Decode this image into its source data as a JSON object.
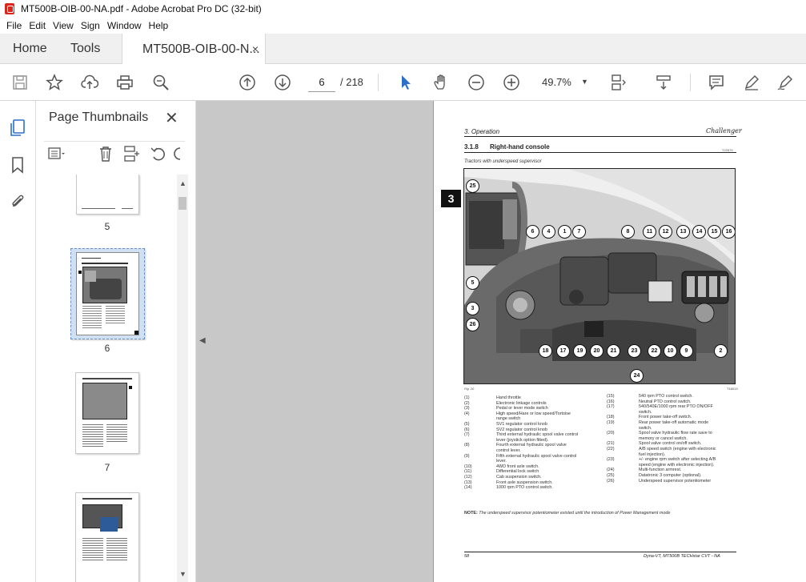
{
  "window": {
    "title": "MT500B-OIB-00-NA.pdf - Adobe Acrobat Pro DC (32-bit)"
  },
  "menu": [
    "File",
    "Edit",
    "View",
    "Sign",
    "Window",
    "Help"
  ],
  "tabs": {
    "home": "Home",
    "tools": "Tools",
    "document": "MT500B-OIB-00-N...",
    "close": "×"
  },
  "toolbar": {
    "page_current": "6",
    "page_total": "/  218",
    "zoom": "49.7%"
  },
  "panel": {
    "title": "Page Thumbnails",
    "close": "✕",
    "thumbnails": [
      {
        "label": "5"
      },
      {
        "label": "6",
        "selected": true
      },
      {
        "label": "7"
      }
    ]
  },
  "page": {
    "section": "3. Operation",
    "logo": "Challenger",
    "heading_num": "3.1.8",
    "heading": "Right-hand console",
    "code": "T22679",
    "subtitle": "Tractors with underspeed supervisor",
    "figure_badge": "3",
    "fig_caption": "Fig. 20",
    "fig_code": "T16013",
    "callouts": [
      "25",
      "6",
      "4",
      "1",
      "7",
      "8",
      "11",
      "12",
      "13",
      "14",
      "15",
      "16",
      "5",
      "3",
      "26",
      "18",
      "17",
      "19",
      "20",
      "21",
      "23",
      "22",
      "10",
      "9",
      "2",
      "24"
    ],
    "legend_left": [
      {
        "n": "(1)",
        "t": "Hand throttle"
      },
      {
        "n": "(2)",
        "t": "Electronic linkage controls"
      },
      {
        "n": "(3)",
        "t": "Pedal or lever mode switch"
      },
      {
        "n": "(4)",
        "t": "High speed/Hare or low speed/Tortoise",
        "t2": "range switch"
      },
      {
        "n": "(5)",
        "t": "SV1 regulator control knob"
      },
      {
        "n": "(6)",
        "t": "SV2 regulator control knob"
      },
      {
        "n": "(7)",
        "t": "Third external hydraulic spool valve control",
        "t2": "lever (joystick option fitted)."
      },
      {
        "n": "(8)",
        "t": "Fourth external hydraulic spool valve",
        "t2": "control lever."
      },
      {
        "n": "(9)",
        "t": "Fifth external hydraulic spool valve control",
        "t2": "lever."
      },
      {
        "n": "(10)",
        "t": "4WD front axle switch."
      },
      {
        "n": "(11)",
        "t": "Differential lock switch"
      },
      {
        "n": "(12)",
        "t": "Cab suspension switch."
      },
      {
        "n": "(13)",
        "t": "Front axle suspension switch."
      },
      {
        "n": "(14)",
        "t": "1000 rpm PTO control switch."
      }
    ],
    "legend_right": [
      {
        "n": "(15)",
        "t": "540 rpm PTO control switch."
      },
      {
        "n": "(16)",
        "t": "Neutral PTO control switch."
      },
      {
        "n": "(17)",
        "t": "540/540E/1000 rpm rear PTO ON/OFF",
        "t2": "switch."
      },
      {
        "n": "(18)",
        "t": "Front power take-off switch."
      },
      {
        "n": "(19)",
        "t": "Rear power take-off automatic mode",
        "t2": "switch."
      },
      {
        "n": "(20)",
        "t": "Spool valve hydraulic flow rate save to",
        "t2": "memory or cancel switch."
      },
      {
        "n": "(21)",
        "t": "Spool valve control on/off switch."
      },
      {
        "n": "(22)",
        "t": "A/B speed switch (engine with electronic",
        "t2": "fuel injection)."
      },
      {
        "n": "(23)",
        "t": "+/- engine rpm switch after selecting A/B",
        "t2": "speed (engine with electronic injection)."
      },
      {
        "n": "(24)",
        "t": "Multi-function armrest."
      },
      {
        "n": "(25)",
        "t": "Datatronic 3 computer (optional)."
      },
      {
        "n": "(26)",
        "t": "Underspeed supervisor potentiometer"
      }
    ],
    "note_label": "NOTE:",
    "note": "The underspeed supervisor potentiometer existed until the introduction of Power Management mode",
    "footer_left": "58",
    "footer_right": "Dyna-VT, MT500B TECHstar CVT - NA"
  },
  "colors": {
    "accent": "#2d6ec9",
    "acrobat_red": "#d9271c",
    "canvas_gray": "#c8c8c8"
  }
}
